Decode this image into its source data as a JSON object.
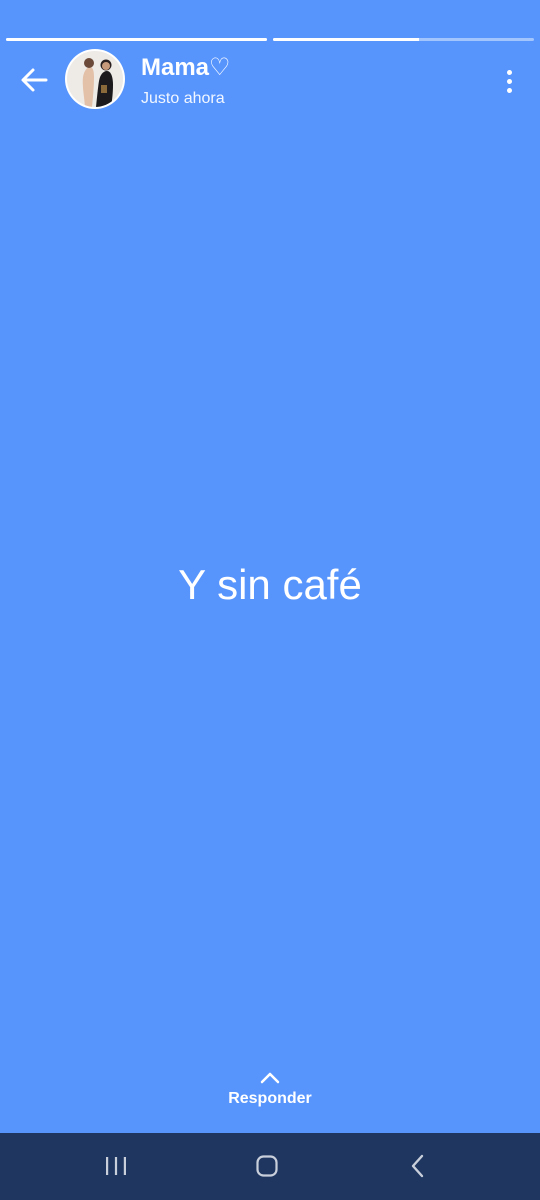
{
  "progress": [
    {
      "fraction": 1.0
    },
    {
      "fraction": 0.56
    }
  ],
  "header": {
    "contact_name": "Mama♡",
    "timestamp": "Justo ahora"
  },
  "status": {
    "text": "Y sin café",
    "background_color": "#5795fd"
  },
  "reply": {
    "label": "Responder",
    "icon": "chevron-up-icon"
  },
  "nav": {
    "background_color": "#1e3660",
    "items": [
      {
        "icon": "recent-apps-icon"
      },
      {
        "icon": "home-icon"
      },
      {
        "icon": "back-icon"
      }
    ]
  }
}
